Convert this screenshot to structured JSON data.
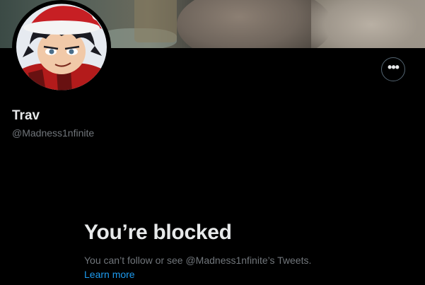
{
  "profile": {
    "display_name": "Trav",
    "handle": "@Madness1nfinite",
    "avatar_icon": "profile-avatar",
    "banner_icon": "profile-banner"
  },
  "actions": {
    "more_label": "•••",
    "more_icon": "more-options-icon"
  },
  "blocked": {
    "title": "You’re blocked",
    "message": "You can’t follow or see @Madness1nfinite’s Tweets.",
    "learn_more": "Learn more"
  },
  "colors": {
    "background": "#000000",
    "text_primary": "#e7e9ea",
    "text_secondary": "#71767b",
    "link": "#1d9bf0"
  }
}
